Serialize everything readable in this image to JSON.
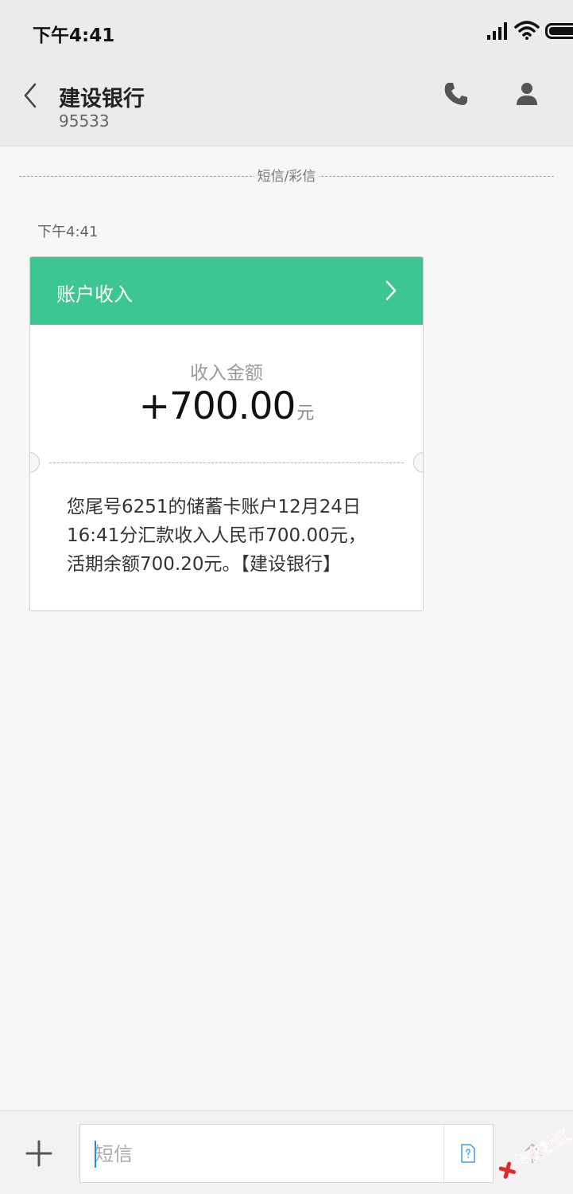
{
  "status_bar": {
    "time": "下午4:41"
  },
  "header": {
    "contact_name": "建设银行",
    "contact_number": "95533"
  },
  "conversation": {
    "divider_label": "短信/彩信",
    "message_time": "下午4:41",
    "card": {
      "title": "账户收入",
      "amount_label": "收入金额",
      "amount_value": "+700.00",
      "amount_unit": "元",
      "body_lines": [
        "您尾号6251的储蓄卡账户12月24日",
        "16:41分汇款收入人民币700.00元，",
        "活期余额700.20元。【建设银行】"
      ],
      "header_color": "#3ec692"
    }
  },
  "input_bar": {
    "placeholder": "短信"
  },
  "watermark": {
    "text": "卡农社区"
  }
}
